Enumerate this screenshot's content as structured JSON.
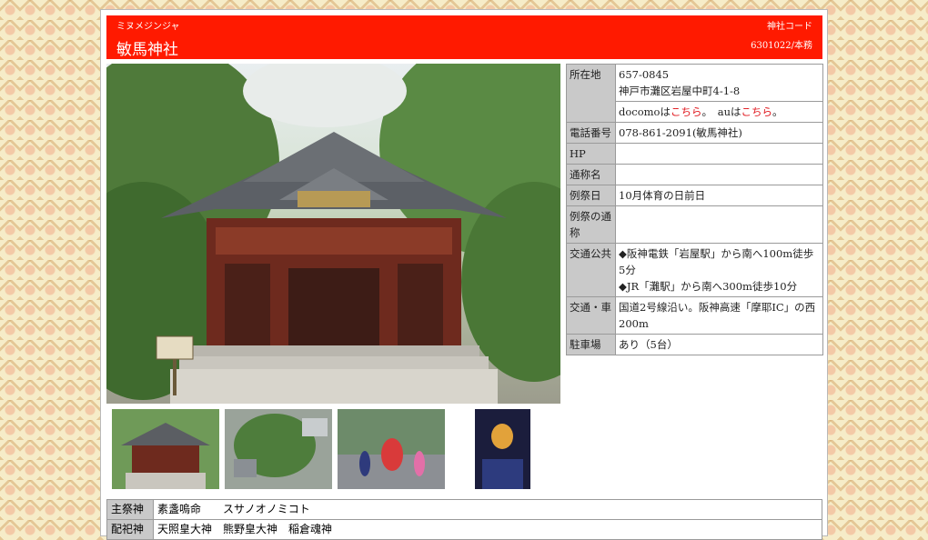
{
  "header": {
    "furigana": "ミヌメジンジャ",
    "name": "敏馬神社",
    "code_label": "神社コード",
    "code_value": "6301022/本務"
  },
  "info": {
    "address_label": "所在地",
    "postal": "657-0845",
    "address": "神戸市灘区岩屋中町4-1-8",
    "docomo_prefix": "docomoは",
    "docomo_link": "こちら",
    "sep": "。　",
    "au_prefix": "auは",
    "au_link": "こちら",
    "end": "。",
    "phone_label": "電話番号",
    "phone": "078-861-2091(敏馬神社)",
    "hp_label": "HP",
    "hp": "",
    "alias_label": "通称名",
    "alias": "",
    "festival_label": "例祭日",
    "festival": "10月体育の日前日",
    "festival_alias_label": "例祭の通称",
    "festival_alias": "",
    "transit_label": "交通公共",
    "transit_1": "◆阪神電鉄「岩屋駅」から南へ100m徒歩5分",
    "transit_2": "◆JR「灘駅」から南へ300m徒歩10分",
    "car_label": "交通・車",
    "car": "国道2号線沿い。阪神高速「摩耶IC」の西200m",
    "parking_label": "駐車場",
    "parking": "あり（5台）"
  },
  "deity": {
    "label": "主祭神",
    "value": "素盞嗚命　　スサノオノミコト",
    "next_label": "配祀神",
    "next_value": "天照皇大神　熊野皇大神　稲倉魂神"
  },
  "images": {
    "main": "shrine-main-hall-photo",
    "thumbs": [
      "shrine-hall-thumb",
      "shrine-aerial-thumb",
      "festival-lion-dance-thumb",
      "lantern-night-thumb"
    ]
  }
}
